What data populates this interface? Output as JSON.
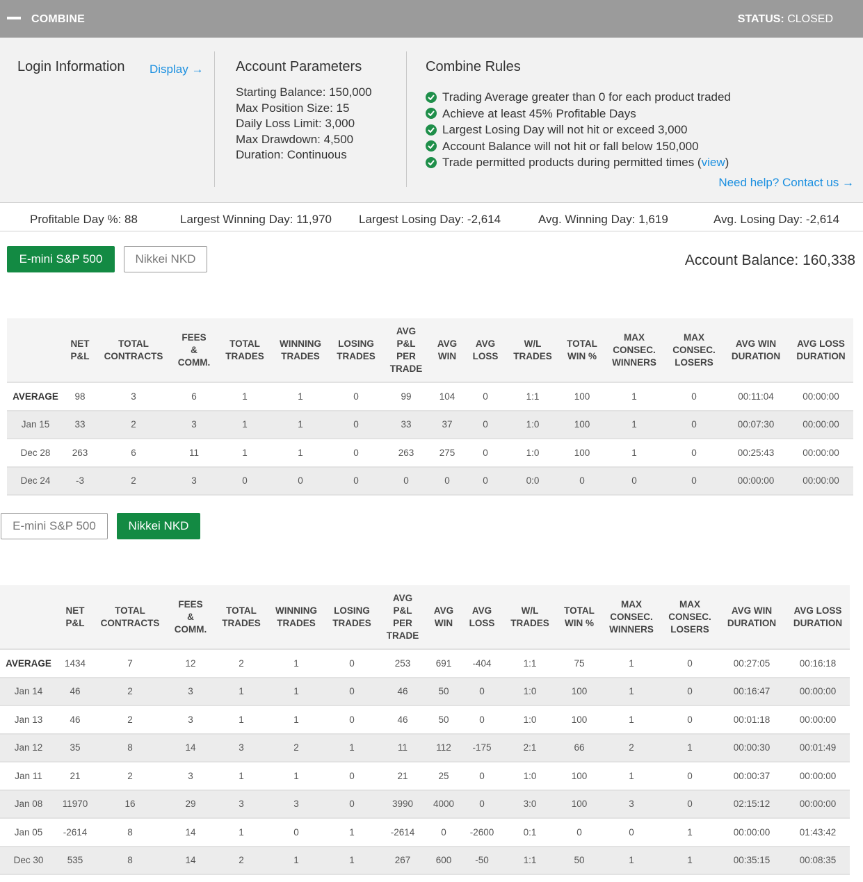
{
  "header": {
    "title": "COMBINE",
    "status_label": "STATUS:",
    "status_value": "CLOSED"
  },
  "login": {
    "heading": "Login Information",
    "display_link": "Display →"
  },
  "account_parameters": {
    "heading": "Account Parameters",
    "items": [
      "Starting Balance: 150,000",
      "Max Position Size: 15",
      "Daily Loss Limit: 3,000",
      "Max Drawdown: 4,500",
      "Duration: Continuous"
    ]
  },
  "combine_rules": {
    "heading": "Combine Rules",
    "items": [
      "Trading Average greater than 0 for each product traded",
      "Achieve at least 45% Profitable Days",
      "Largest Losing Day will not hit or exceed 3,000",
      "Account Balance will not hit or fall below 150,000"
    ],
    "last_rule_text": "Trade permitted products during permitted times (",
    "last_rule_link": "view",
    "last_rule_close": ")",
    "help_link": "Need help? Contact us →"
  },
  "stats": {
    "profitable_day": "Profitable Day %: 88",
    "largest_winning_day": "Largest Winning Day: 11,970",
    "largest_losing_day": "Largest Losing Day: -2,614",
    "avg_winning_day": "Avg. Winning Day: 1,619",
    "avg_losing_day": "Avg. Losing Day: -2,614"
  },
  "account_balance": "Account Balance: 160,338",
  "columns": [
    "",
    "NET P&L",
    "TOTAL CONTRACTS",
    "FEES & COMM.",
    "TOTAL TRADES",
    "WINNING TRADES",
    "LOSING TRADES",
    "AVG P&L PER TRADE",
    "AVG WIN",
    "AVG LOSS",
    "W/L TRADES",
    "TOTAL WIN %",
    "MAX CONSEC. WINNERS",
    "MAX CONSEC. LOSERS",
    "AVG WIN DURATION",
    "AVG LOSS DURATION"
  ],
  "sections": [
    {
      "tabs": [
        {
          "label": "E-mini S&P 500",
          "active": true
        },
        {
          "label": "Nikkei NKD",
          "active": false
        }
      ],
      "rows": [
        [
          "AVERAGE",
          "98",
          "3",
          "6",
          "1",
          "1",
          "0",
          "99",
          "104",
          "0",
          "1:1",
          "100",
          "1",
          "0",
          "00:11:04",
          "00:00:00"
        ],
        [
          "Jan 15",
          "33",
          "2",
          "3",
          "1",
          "1",
          "0",
          "33",
          "37",
          "0",
          "1:0",
          "100",
          "1",
          "0",
          "00:07:30",
          "00:00:00"
        ],
        [
          "Dec 28",
          "263",
          "6",
          "11",
          "1",
          "1",
          "0",
          "263",
          "275",
          "0",
          "1:0",
          "100",
          "1",
          "0",
          "00:25:43",
          "00:00:00"
        ],
        [
          "Dec 24",
          "-3",
          "2",
          "3",
          "0",
          "0",
          "0",
          "0",
          "0",
          "0",
          "0:0",
          "0",
          "0",
          "0",
          "00:00:00",
          "00:00:00"
        ]
      ]
    },
    {
      "tabs": [
        {
          "label": "E-mini S&P 500",
          "active": false
        },
        {
          "label": "Nikkei NKD",
          "active": true
        }
      ],
      "rows": [
        [
          "AVERAGE",
          "1434",
          "7",
          "12",
          "2",
          "1",
          "0",
          "253",
          "691",
          "-404",
          "1:1",
          "75",
          "1",
          "0",
          "00:27:05",
          "00:16:18"
        ],
        [
          "Jan 14",
          "46",
          "2",
          "3",
          "1",
          "1",
          "0",
          "46",
          "50",
          "0",
          "1:0",
          "100",
          "1",
          "0",
          "00:16:47",
          "00:00:00"
        ],
        [
          "Jan 13",
          "46",
          "2",
          "3",
          "1",
          "1",
          "0",
          "46",
          "50",
          "0",
          "1:0",
          "100",
          "1",
          "0",
          "00:01:18",
          "00:00:00"
        ],
        [
          "Jan 12",
          "35",
          "8",
          "14",
          "3",
          "2",
          "1",
          "11",
          "112",
          "-175",
          "2:1",
          "66",
          "2",
          "1",
          "00:00:30",
          "00:01:49"
        ],
        [
          "Jan 11",
          "21",
          "2",
          "3",
          "1",
          "1",
          "0",
          "21",
          "25",
          "0",
          "1:0",
          "100",
          "1",
          "0",
          "00:00:37",
          "00:00:00"
        ],
        [
          "Jan 08",
          "11970",
          "16",
          "29",
          "3",
          "3",
          "0",
          "3990",
          "4000",
          "0",
          "3:0",
          "100",
          "3",
          "0",
          "02:15:12",
          "00:00:00"
        ],
        [
          "Jan 05",
          "-2614",
          "8",
          "14",
          "1",
          "0",
          "1",
          "-2614",
          "0",
          "-2600",
          "0:1",
          "0",
          "0",
          "1",
          "00:00:00",
          "01:43:42"
        ],
        [
          "Dec 30",
          "535",
          "8",
          "14",
          "2",
          "1",
          "1",
          "267",
          "600",
          "-50",
          "1:1",
          "50",
          "1",
          "1",
          "00:35:15",
          "00:08:35"
        ]
      ]
    }
  ]
}
